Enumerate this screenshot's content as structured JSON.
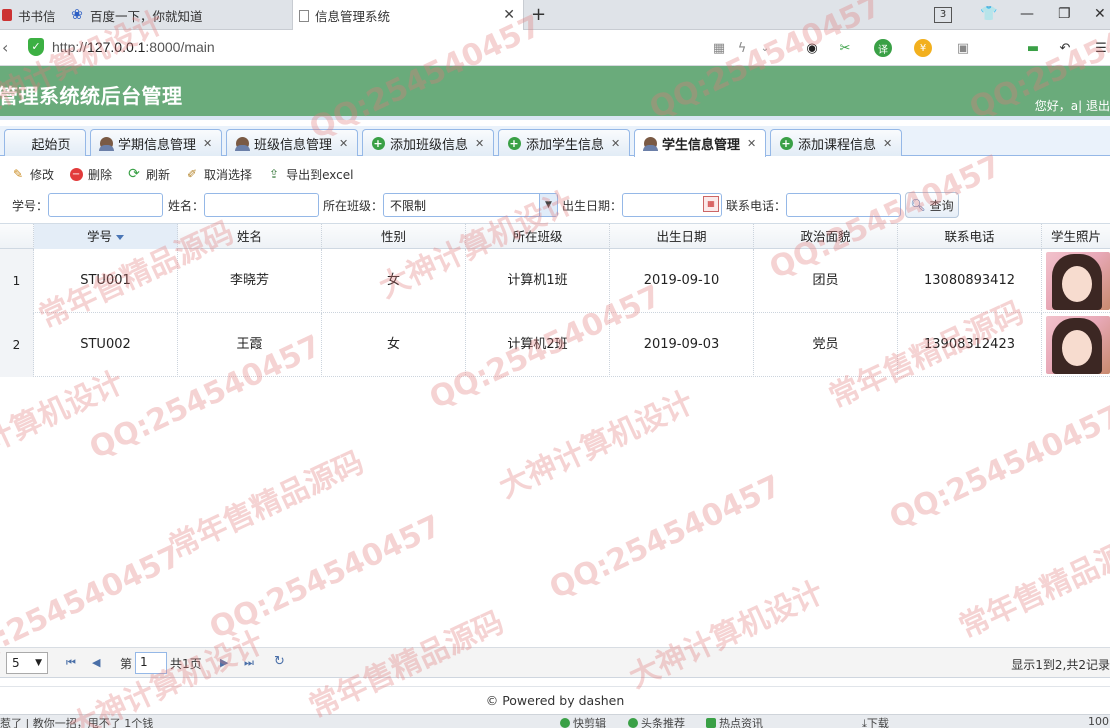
{
  "browser": {
    "tabs": [
      {
        "label": "书书信"
      },
      {
        "label": "百度一下，你就知道"
      },
      {
        "label": "信息管理系统"
      }
    ],
    "tab_count": "3",
    "url_prefix": "http://",
    "url_host": "127.0.0.1",
    "url_rest": ":8000/main"
  },
  "header": {
    "title": "管理系统统后台管理",
    "greeting": "您好，a| 退出"
  },
  "inner_tabs": [
    {
      "label": "起始页"
    },
    {
      "label": "学期信息管理"
    },
    {
      "label": "班级信息管理"
    },
    {
      "label": "添加班级信息"
    },
    {
      "label": "添加学生信息"
    },
    {
      "label": "学生信息管理"
    },
    {
      "label": "添加课程信息"
    }
  ],
  "toolbar": {
    "edit": "修改",
    "delete": "删除",
    "refresh": "刷新",
    "unselect": "取消选择",
    "export": "导出到excel"
  },
  "search": {
    "student_no_label": "学号：",
    "name_label": "姓名：",
    "class_label": "所在班级：",
    "class_value": "不限制",
    "birth_label": "出生日期：",
    "phone_label": "联系电话：",
    "query_button": "查询"
  },
  "grid": {
    "columns": [
      "学号",
      "姓名",
      "性别",
      "所在班级",
      "出生日期",
      "政治面貌",
      "联系电话",
      "学生照片"
    ],
    "rows": [
      {
        "rownum": "1",
        "student_no": "STU001",
        "name": "李晓芳",
        "gender": "女",
        "class": "计算机1班",
        "birth": "2019-09-10",
        "politics": "团员",
        "phone": "13080893412"
      },
      {
        "rownum": "2",
        "student_no": "STU002",
        "name": "王霞",
        "gender": "女",
        "class": "计算机2班",
        "birth": "2019-09-03",
        "politics": "党员",
        "phone": "13908312423"
      }
    ]
  },
  "pager": {
    "page_size": "5",
    "page_prefix": "第",
    "page_number": "1",
    "page_total": "共1页",
    "info": "显示1到2,共2记录"
  },
  "footer": {
    "text": "© Powered by dashen"
  },
  "statusbar": {
    "left": "惹了 | 教你一招，甩不了 1个钱",
    "item1": "快剪辑",
    "item2": "头条推荐",
    "item3": "热点资讯",
    "download": "下载",
    "zoom": "100"
  },
  "watermark": {
    "qq": "QQ:254540457",
    "shop": "常年售精品源码",
    "design": "大神计算机设计"
  }
}
